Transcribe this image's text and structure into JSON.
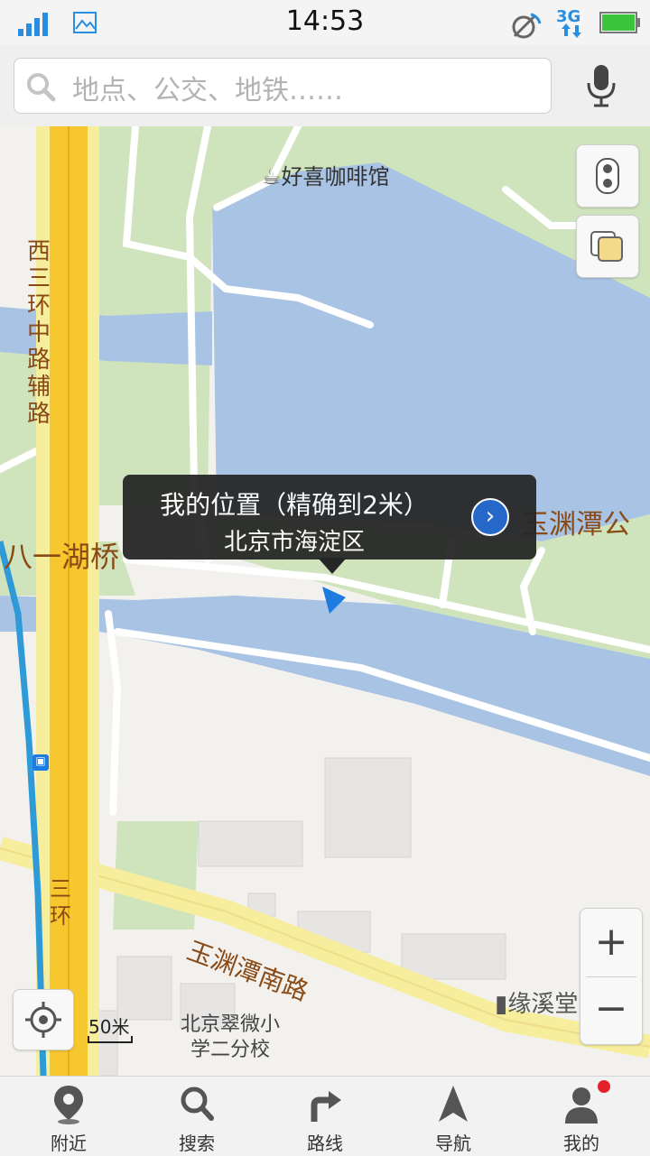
{
  "status_bar": {
    "time": "14:53",
    "network": "3G"
  },
  "search": {
    "placeholder": "地点、公交、地铁……"
  },
  "map": {
    "poi_cafe": "好喜咖啡馆",
    "road_xisanhuan_fulu": "西三环中路辅路",
    "bridge_bayi": "八一湖桥",
    "park_yuyuantan": "玉渊潭公",
    "road_yuyuantan_nan": "玉渊潭南路",
    "poi_yuanxi": "缘溪堂",
    "school": {
      "line1": "北京翠微小",
      "line2": "学二分校"
    },
    "road_sanhuan": "三环",
    "scale_label": "50米",
    "my_location": {
      "title": "我的位置（精确到2米）",
      "district": "北京市海淀区"
    }
  },
  "bottom_nav": {
    "items": [
      {
        "label": "附近",
        "icon": "location-pin-icon"
      },
      {
        "label": "搜索",
        "icon": "search-icon"
      },
      {
        "label": "路线",
        "icon": "route-icon"
      },
      {
        "label": "导航",
        "icon": "navigation-arrow-icon"
      },
      {
        "label": "我的",
        "icon": "user-icon"
      }
    ]
  },
  "colors": {
    "water": "#a8c3e3",
    "park": "#cfe3bd",
    "highway": "#f6c72e",
    "road": "#ffffff",
    "subway": "#2e9bd8",
    "accent": "#1e63c8"
  }
}
